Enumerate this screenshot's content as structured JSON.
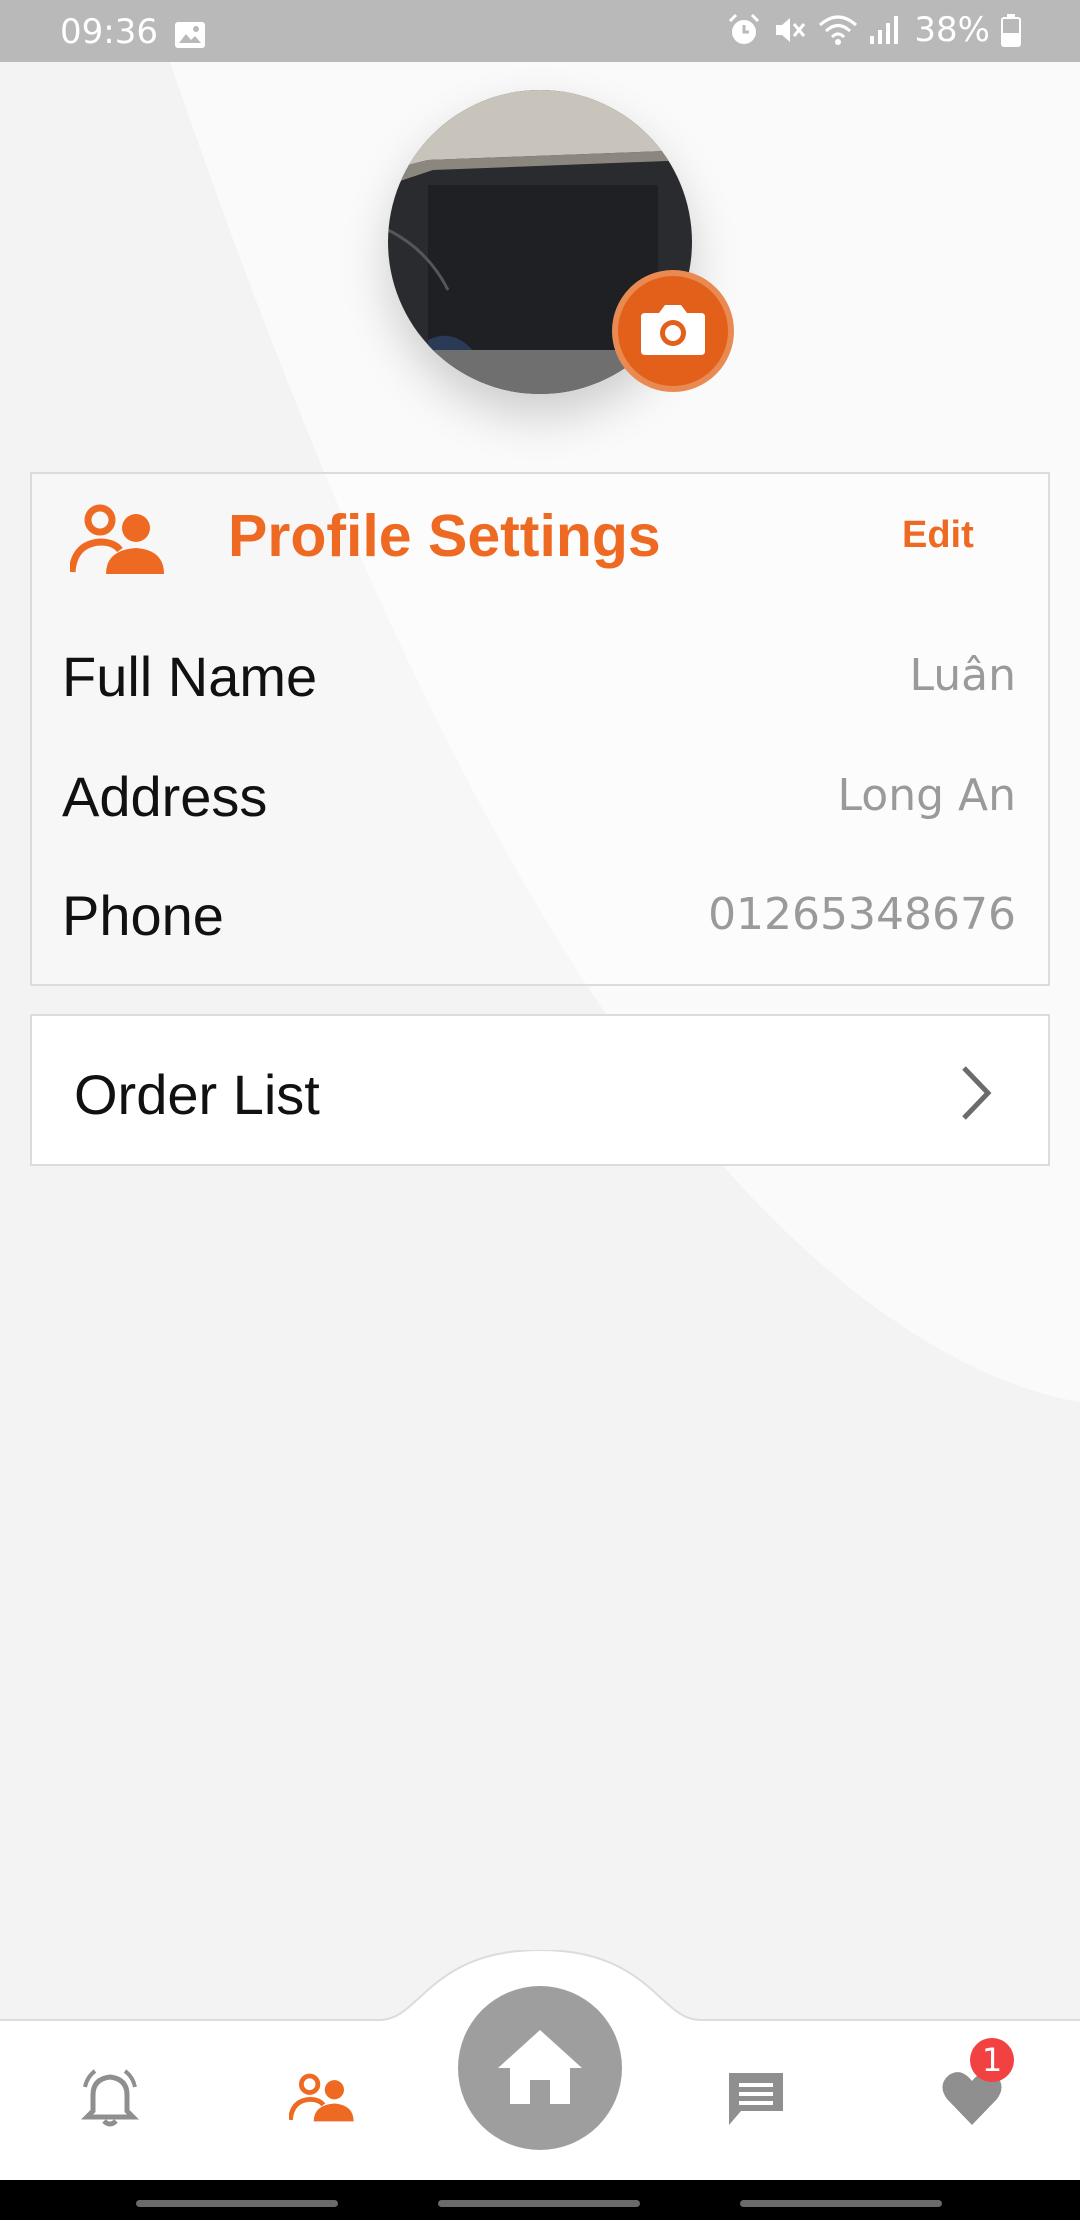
{
  "status_bar": {
    "time": "09:36",
    "battery": "38%",
    "icons": [
      "image-icon",
      "alarm-icon",
      "mute-icon",
      "wifi-icon",
      "signal-icon",
      "battery-icon"
    ]
  },
  "avatar": {
    "camera_icon": "camera-icon"
  },
  "profile": {
    "title": "Profile Settings",
    "edit_label": "Edit",
    "fields": [
      {
        "label": "Full Name",
        "value": "Luân"
      },
      {
        "label": "Address",
        "value": "Long An"
      },
      {
        "label": "Phone",
        "value": "01265348676"
      }
    ]
  },
  "order_list": {
    "label": "Order List"
  },
  "bottom_nav": {
    "items": [
      "notifications-icon",
      "profile-icon",
      "home-icon",
      "messages-icon",
      "favorites-icon"
    ],
    "active": "profile-icon",
    "favorites_badge": "1"
  },
  "colors": {
    "accent": "#ee6a22",
    "camera_button": "#e2601a",
    "nav_inactive": "#8f8f8f",
    "badge": "#f24141"
  }
}
